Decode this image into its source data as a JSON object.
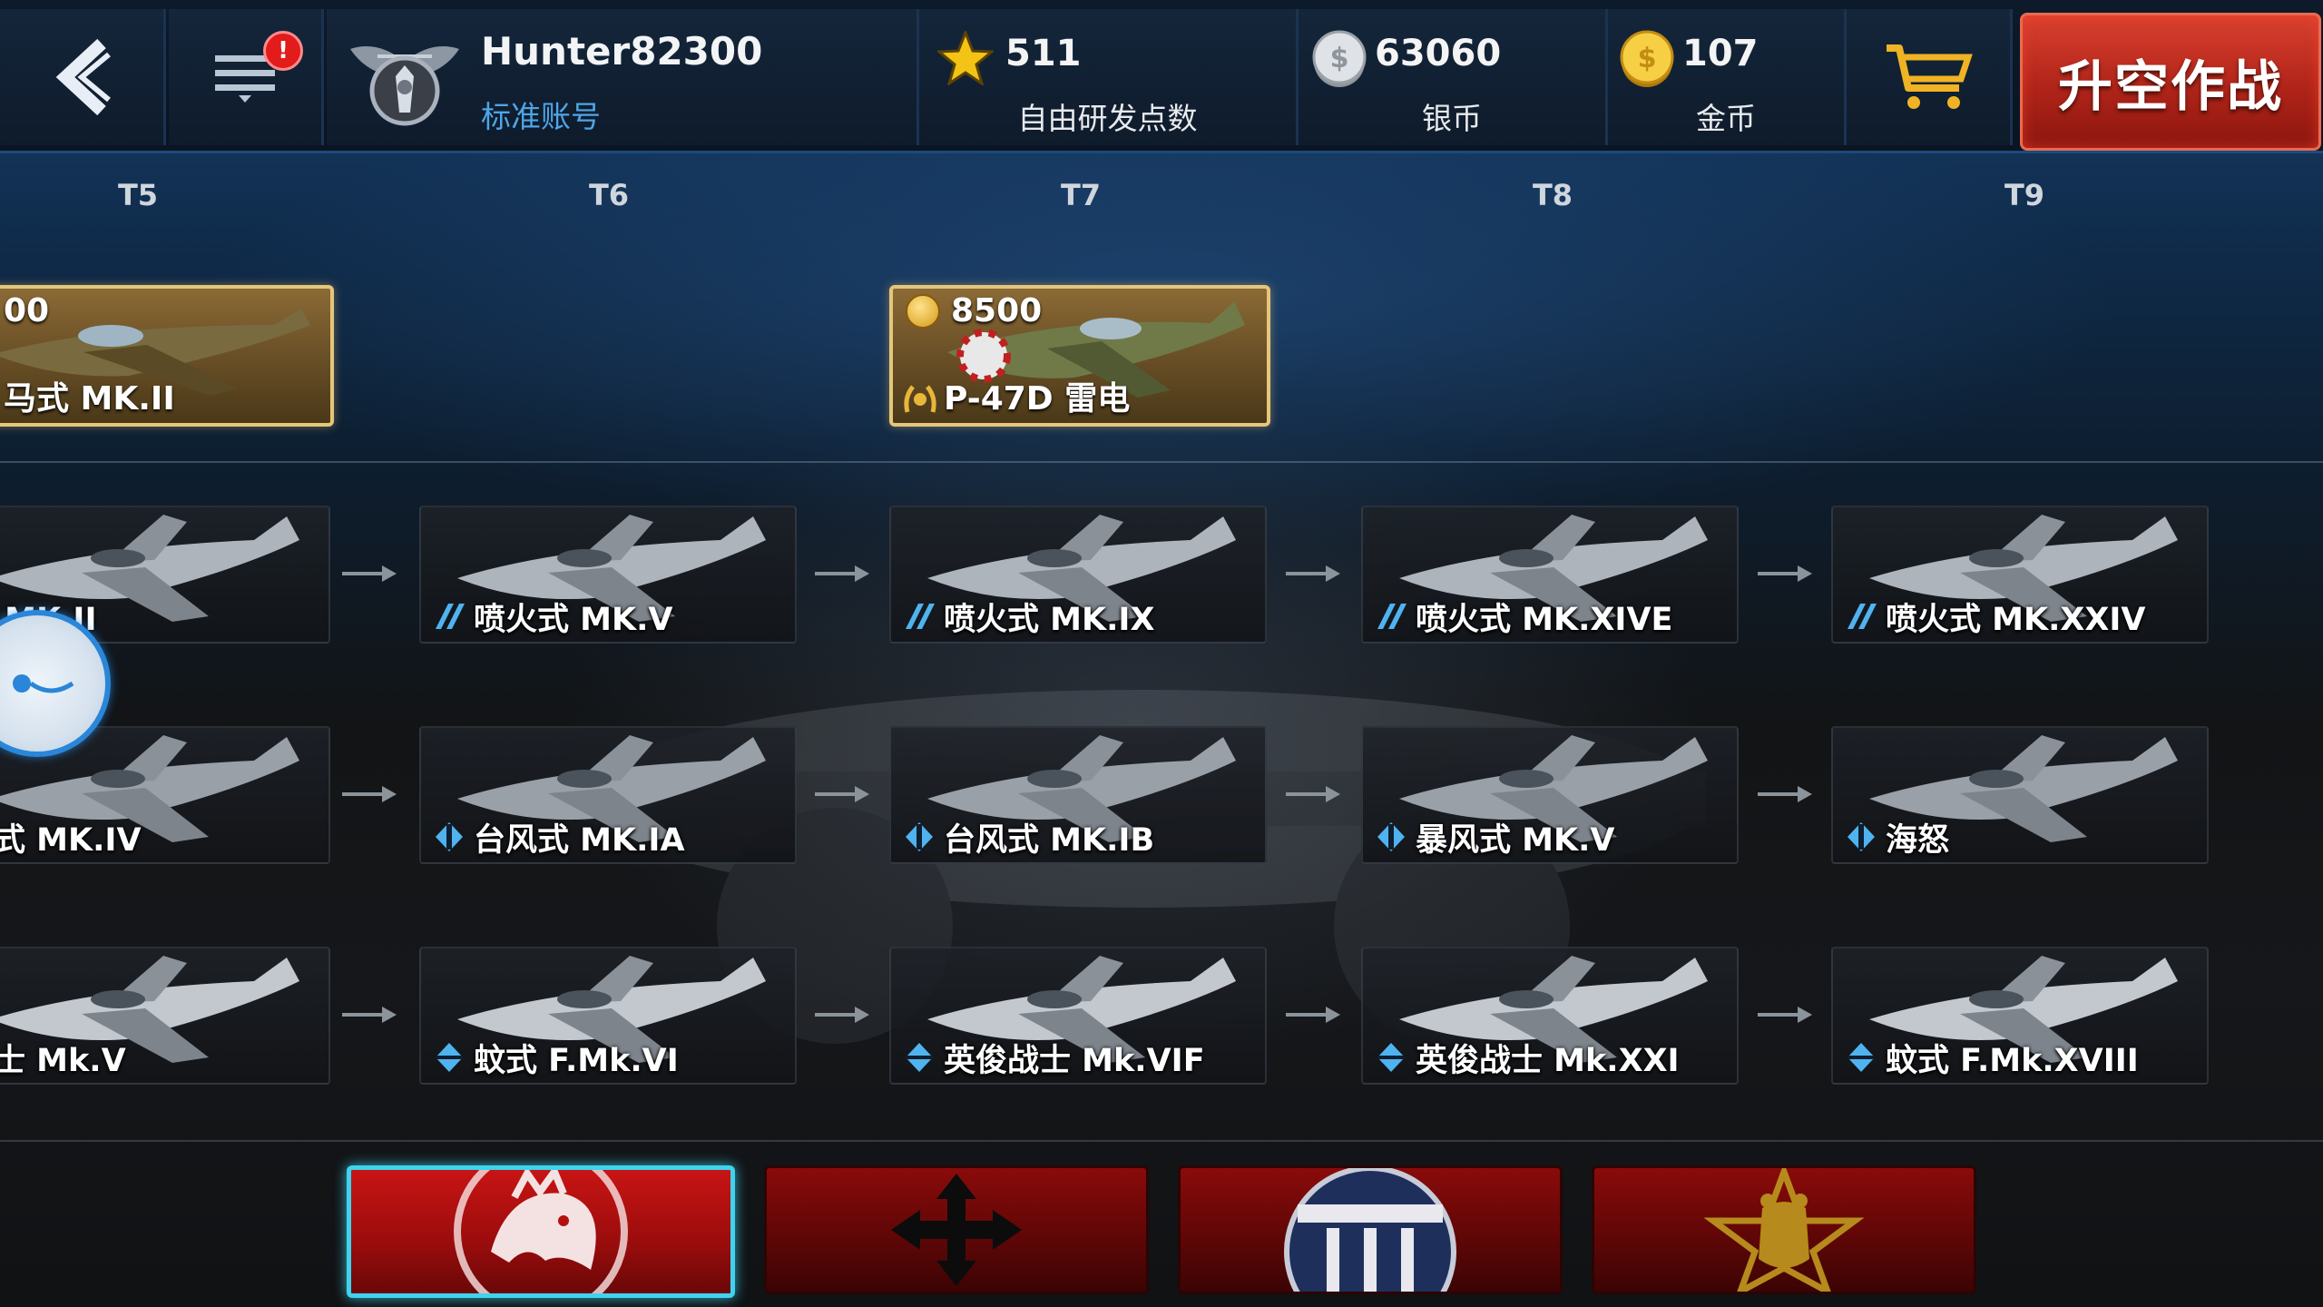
{
  "topbar": {
    "badge": "!",
    "profile": {
      "username": "Hunter82300",
      "account_type": "标准账号"
    },
    "resources": {
      "research_points": {
        "value": "511",
        "label": "自由研发点数"
      },
      "silver": {
        "value": "63060",
        "label": "银币"
      },
      "gold": {
        "value": "107",
        "label": "金币"
      }
    },
    "fly_button": "升空作战"
  },
  "tiers": [
    "T5",
    "T6",
    "T7",
    "T8",
    "T9"
  ],
  "premium": [
    {
      "price": "00",
      "name": "马式 MK.II"
    },
    {
      "price": "8500",
      "name": "P-47D 雷电"
    }
  ],
  "tree": {
    "rows": [
      [
        "式 MK.II",
        "喷火式 MK.V",
        "喷火式 MK.IX",
        "喷火式 MK.XIVE",
        "喷火式 MK.XXIV"
      ],
      [
        "风式 MK.IV",
        "台风式 MK.IA",
        "台风式 MK.IB",
        "暴风式 MK.V",
        "海怒"
      ],
      [
        "战士 Mk.V",
        "蚊式 F.Mk.VI",
        "英俊战士 Mk.VIF",
        "英俊战士 Mk.XXI",
        "蚊式 F.Mk.XVIII"
      ]
    ]
  },
  "nations": [
    {
      "name": "britain-lion",
      "active": true
    },
    {
      "name": "germany-cross",
      "active": false
    },
    {
      "name": "usa-roundel",
      "active": false
    },
    {
      "name": "ussr-bear",
      "active": false
    }
  ],
  "colors": {
    "accent_blue": "#3fd3ef",
    "fly_red": "#c22a1e",
    "premium_gold": "#e5c67a"
  }
}
